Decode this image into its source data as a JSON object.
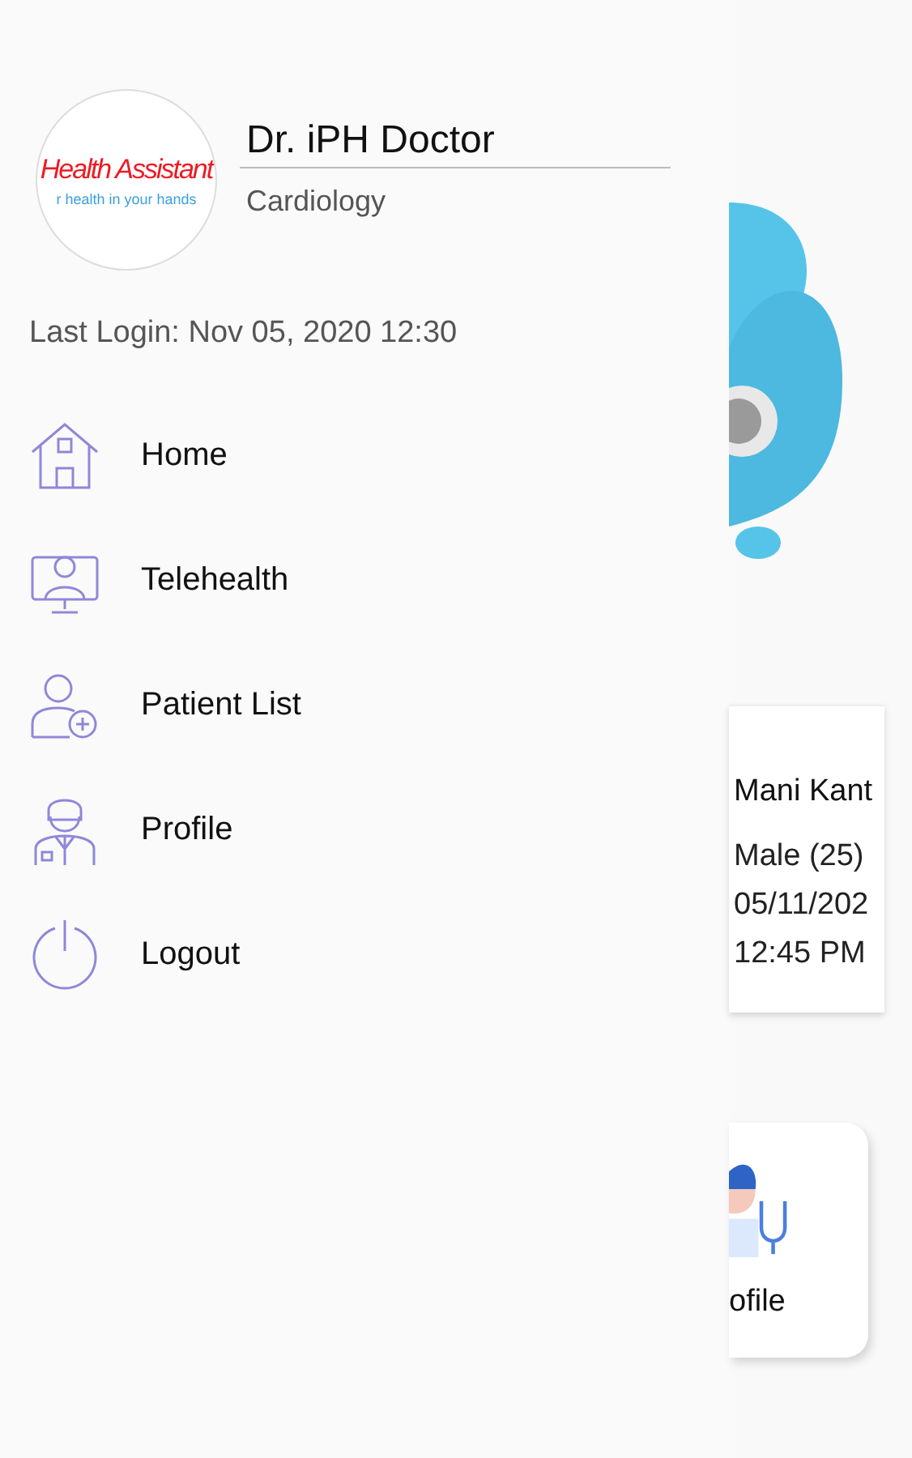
{
  "drawer": {
    "avatar": {
      "logo_title": "Health Assistant",
      "logo_tagline": "r health in your hands"
    },
    "name": "Dr. iPH Doctor",
    "specialty": "Cardiology",
    "last_login": "Last Login: Nov 05, 2020 12:30",
    "menu": [
      {
        "kind": "home",
        "label": "Home"
      },
      {
        "kind": "telehealth",
        "label": "Telehealth"
      },
      {
        "kind": "patients",
        "label": "Patient List"
      },
      {
        "kind": "profile",
        "label": "Profile"
      },
      {
        "kind": "logout",
        "label": "Logout"
      }
    ]
  },
  "background": {
    "patient_card": {
      "name": "Mani Kant",
      "gender_age": "Male (25)",
      "date": "05/11/202",
      "time": "12:45 PM"
    },
    "tile": {
      "label": "ofile"
    }
  }
}
